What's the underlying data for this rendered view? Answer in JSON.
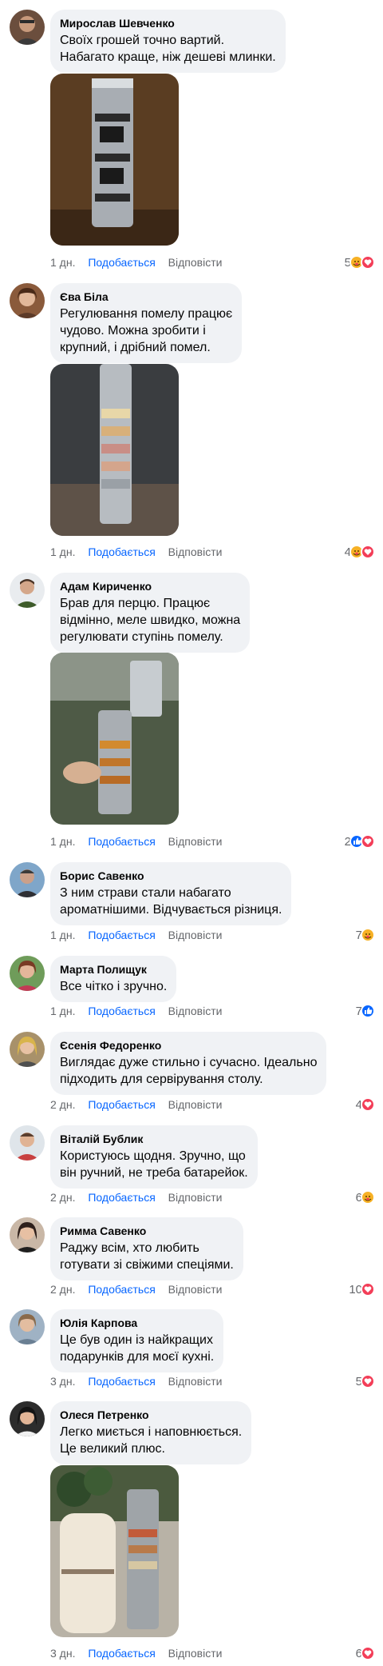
{
  "comments": [
    {
      "author": "Мирослав Шевченко",
      "text": "Своїх грошей точно вартий.\nНабагато краще, ніж дешеві млинки.",
      "time": "1 дн.",
      "like_label": "Подобається",
      "reply_label": "Відповісти",
      "reaction_count": "5",
      "reactions": [
        "care",
        "love"
      ],
      "has_photo": true
    },
    {
      "author": "Єва Біла",
      "text": "Регулювання помелу працює\nчудово. Можна зробити і\nкрупний, і дрібний помел.",
      "time": "1 дн.",
      "like_label": "Подобається",
      "reply_label": "Відповісти",
      "reaction_count": "4",
      "reactions": [
        "care",
        "love"
      ],
      "has_photo": true
    },
    {
      "author": "Адам Кириченко",
      "text": "Брав для перцю. Працює\nвідмінно, меле швидко, можна\nрегулювати ступінь помелу.",
      "time": "1 дн.",
      "like_label": "Подобається",
      "reply_label": "Відповісти",
      "reaction_count": "2",
      "reactions": [
        "like",
        "love"
      ],
      "has_photo": true
    },
    {
      "author": "Борис Савенко",
      "text": "З ним страви стали набагато\nароматнішими. Відчувається різниця.",
      "time": "1 дн.",
      "like_label": "Подобається",
      "reply_label": "Відповісти",
      "reaction_count": "7",
      "reactions": [
        "care"
      ],
      "has_photo": false
    },
    {
      "author": "Марта Полищук",
      "text": "Все чітко і зручно.",
      "time": "1 дн.",
      "like_label": "Подобається",
      "reply_label": "Відповісти",
      "reaction_count": "7",
      "reactions": [
        "like"
      ],
      "has_photo": false
    },
    {
      "author": "Єсенія Федоренко",
      "text": "Виглядає дуже стильно і сучасно. Ідеально\nпідходить для сервірування столу.",
      "time": "2 дн.",
      "like_label": "Подобається",
      "reply_label": "Відповісти",
      "reaction_count": "4",
      "reactions": [
        "love"
      ],
      "has_photo": false
    },
    {
      "author": "Віталій Бублик",
      "text": "Користуюсь щодня. Зручно, що\nвін ручний, не треба батарейок.",
      "time": "2 дн.",
      "like_label": "Подобається",
      "reply_label": "Відповісти",
      "reaction_count": "6",
      "reactions": [
        "care"
      ],
      "has_photo": false
    },
    {
      "author": "Римма Савенко",
      "text": "Раджу всім, хто любить\nготувати зі свіжими спеціями.",
      "time": "2 дн.",
      "like_label": "Подобається",
      "reply_label": "Відповісти",
      "reaction_count": "10",
      "reactions": [
        "love"
      ],
      "has_photo": false
    },
    {
      "author": "Юлія Карпова",
      "text": "Це був один із найкращих\nподарунків для моєї кухні.",
      "time": "3 дн.",
      "like_label": "Подобається",
      "reply_label": "Відповісти",
      "reaction_count": "5",
      "reactions": [
        "love"
      ],
      "has_photo": false
    },
    {
      "author": "Олеся Петренко",
      "text": "Легко миється і наповнюється.\nЦе великий плюс.",
      "time": "3 дн.",
      "like_label": "Подобається",
      "reply_label": "Відповісти",
      "reaction_count": "6",
      "reactions": [
        "love"
      ],
      "has_photo": true
    }
  ],
  "colors": {
    "bubble": "#f0f2f5",
    "like_blue": "#0866ff",
    "meta_gray": "#65676b",
    "love_red": "#f33e58",
    "care_yellow": "#f7b125"
  }
}
